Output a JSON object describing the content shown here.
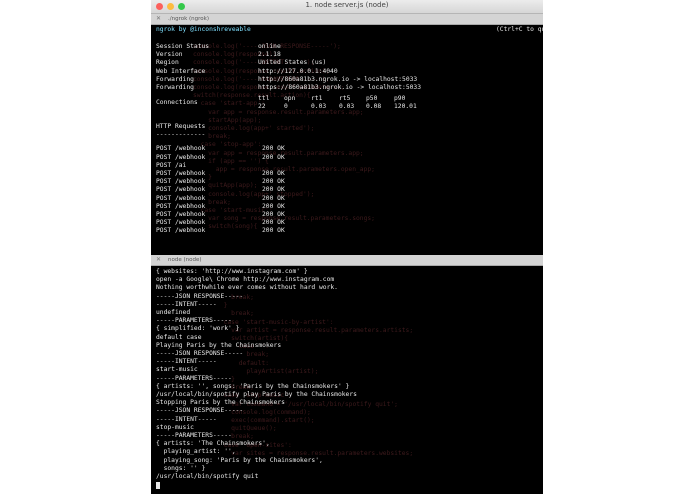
{
  "window": {
    "title": "1. node server.js (node)"
  },
  "tab1": {
    "label": "./ngrok (ngrok)"
  },
  "tab2": {
    "label": "node (node)"
  },
  "ngrok": {
    "header": "ngrok by @inconshreveable",
    "quit_hint": "(Ctrl+C to qu",
    "session_status_label": "Session Status",
    "session_status_value": "online",
    "version_label": "Version",
    "version_value": "2.1.18",
    "region_label": "Region",
    "region_value": "United States (us)",
    "web_interface_label": "Web Interface",
    "web_interface_value": "http://127.0.0.1:4040",
    "forwarding_label": "Forwarding",
    "forwarding_1": "http://860a81b3.ngrok.io -> localhost:5033",
    "forwarding_2": "https://860a81b3.ngrok.io -> localhost:5033",
    "connections_label": "Connections",
    "conn_headers": [
      "ttl",
      "opn",
      "rt1",
      "rt5",
      "p50",
      "p90"
    ],
    "conn_values": [
      "22",
      "0",
      "0.03",
      "0.03",
      "0.08",
      "120.01"
    ],
    "http_requests_label": "HTTP Requests",
    "http_requests_rule": "-------------",
    "requests": [
      {
        "path": "POST /webhook",
        "status": "200 OK"
      },
      {
        "path": "POST /webhook",
        "status": "200 OK"
      },
      {
        "path": "POST /ai",
        "status": ""
      },
      {
        "path": "POST /webhook",
        "status": "200 OK"
      },
      {
        "path": "POST /webhook",
        "status": "200 OK"
      },
      {
        "path": "POST /webhook",
        "status": "200 OK"
      },
      {
        "path": "POST /webhook",
        "status": "200 OK"
      },
      {
        "path": "POST /webhook",
        "status": "200 OK"
      },
      {
        "path": "POST /webhook",
        "status": "200 OK"
      },
      {
        "path": "POST /webhook",
        "status": "200 OK"
      },
      {
        "path": "POST /webhook",
        "status": "200 OK"
      }
    ],
    "ghost_code": [
      "console.log('-----JSON RESPONSE-----');",
      "console.log(response);",
      "console.log('-----INTENT-----');",
      "console.log(response.result.action);",
      "console.log('-----PARAMETERS-----');",
      "console.log(response.result.parameters);",
      "switch(response.result.action){",
      "  case 'start-app':",
      "    var app = response.result.parameters.app;",
      "    startApp(app);",
      "    console.log(app+' started');",
      "    break;",
      "  case 'stop-app':",
      "    var app = response.result.parameters.app;",
      "    if (app == '') {",
      "      app = response.result.parameters.open_app;",
      "    }",
      "    quitApp(app);",
      "    console.log(app+' stopped');",
      "    break;",
      "  case 'start-music':",
      "    var song = response.result.parameters.songs;",
      "    switch(song){"
    ]
  },
  "node": {
    "lines": [
      "{ websites: 'http://www.instagram.com' }",
      "open -a Google\\ Chrome http://www.instagram.com",
      "Nothing worthwhile ever comes without hard work.",
      "-----JSON RESPONSE-----",
      "-----INTENT-----",
      "undefined",
      "-----PARAMETERS-----",
      "{ simplified: 'work' }",
      "default case",
      "Playing Paris by the Chainsmokers",
      "-----JSON RESPONSE-----",
      "-----INTENT-----",
      "start-music",
      "-----PARAMETERS-----",
      "{ artists: '', songs: 'Paris by the Chainsmokers' }",
      "/usr/local/bin/spotify play Paris by the Chainsmokers",
      "Stopping Paris by the Chainsmokers",
      "-----JSON RESPONSE-----",
      "-----INTENT-----",
      "stop-music",
      "-----PARAMETERS-----",
      "{ artists: 'The Chainsmokers',",
      "  playing_artist: '',",
      "  playing_song: 'Paris by the Chainsmokers',",
      "  songs: '' }",
      "/usr/local/bin/spotify quit"
    ],
    "ghost_code": [
      "    break;",
      "  }",
      "    break;",
      "  case 'start-music-by-artist':",
      "    var artist = response.result.parameters.artists;",
      "    switch(artist){",
      "      case '':",
      "        break;",
      "      default:",
      "        playArtist(artist);",
      "    }",
      "    break;",
      "  case 'stop-music':",
      "    var command = '/usr/local/bin/spotify quit';",
      "    console.log(command);",
      "    exec(command).start();",
      "    quitQueue();",
      "    break;",
      "  case 'open-sites':",
      "    var sites = response.result.parameters.websites;"
    ]
  },
  "colors": {
    "online": "#3ee05a",
    "header": "#7fe0ff",
    "ghost": "#3d1a1c"
  }
}
